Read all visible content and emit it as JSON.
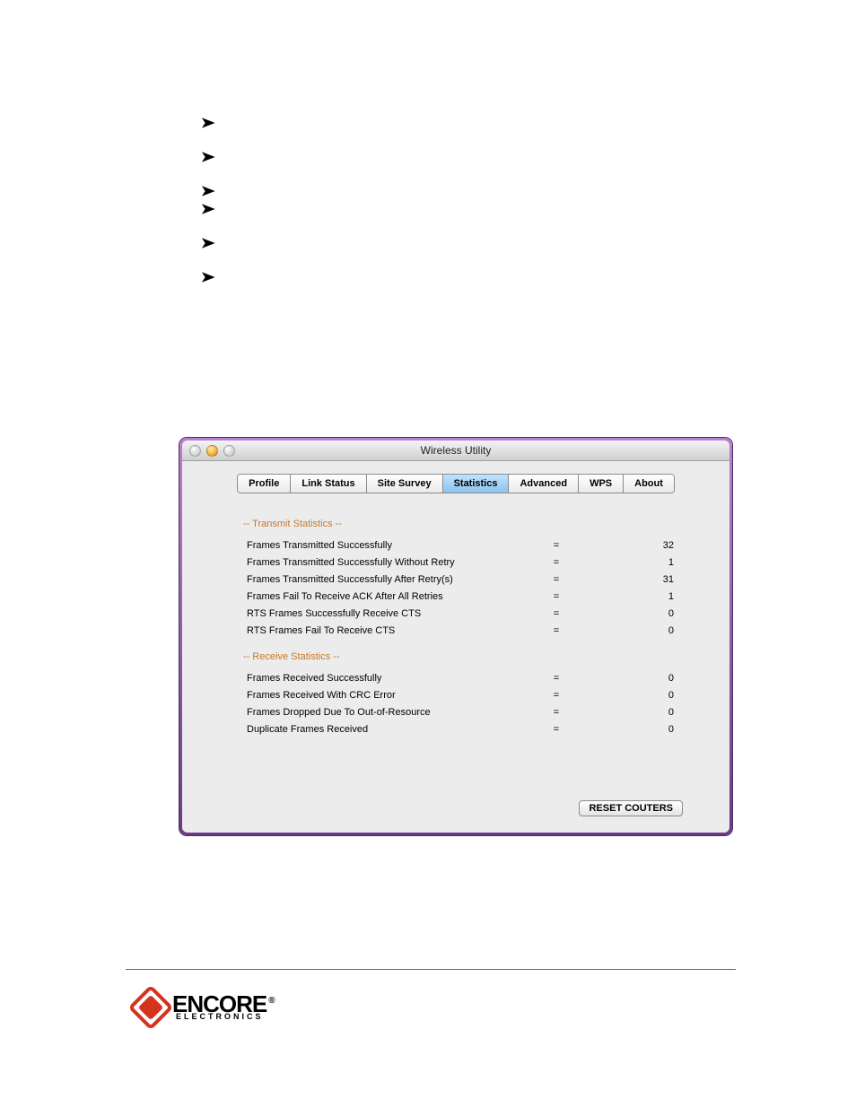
{
  "window": {
    "title": "Wireless Utility",
    "tabs": [
      "Profile",
      "Link Status",
      "Site Survey",
      "Statistics",
      "Advanced",
      "WPS",
      "About"
    ],
    "active_tab": "Statistics",
    "reset_label": "RESET COUTERS"
  },
  "transmit": {
    "header": "-- Transmit Statistics --",
    "rows": [
      {
        "label": "Frames Transmitted Successfully",
        "value": "32"
      },
      {
        "label": "Frames Transmitted Successfully Without Retry",
        "value": "1"
      },
      {
        "label": "Frames Transmitted Successfully After Retry(s)",
        "value": "31"
      },
      {
        "label": "Frames Fail To Receive ACK After All Retries",
        "value": "1"
      },
      {
        "label": "RTS Frames Successfully Receive CTS",
        "value": "0"
      },
      {
        "label": "RTS Frames Fail To Receive CTS",
        "value": "0"
      }
    ]
  },
  "receive": {
    "header": "-- Receive Statistics --",
    "rows": [
      {
        "label": "Frames Received Successfully",
        "value": "0"
      },
      {
        "label": "Frames Received With CRC Error",
        "value": "0"
      },
      {
        "label": "Frames Dropped Due To Out-of-Resource",
        "value": "0"
      },
      {
        "label": "Duplicate Frames Received",
        "value": "0"
      }
    ]
  },
  "logo": {
    "brand": "ENCORE",
    "sub": "ELECTRONICS"
  }
}
